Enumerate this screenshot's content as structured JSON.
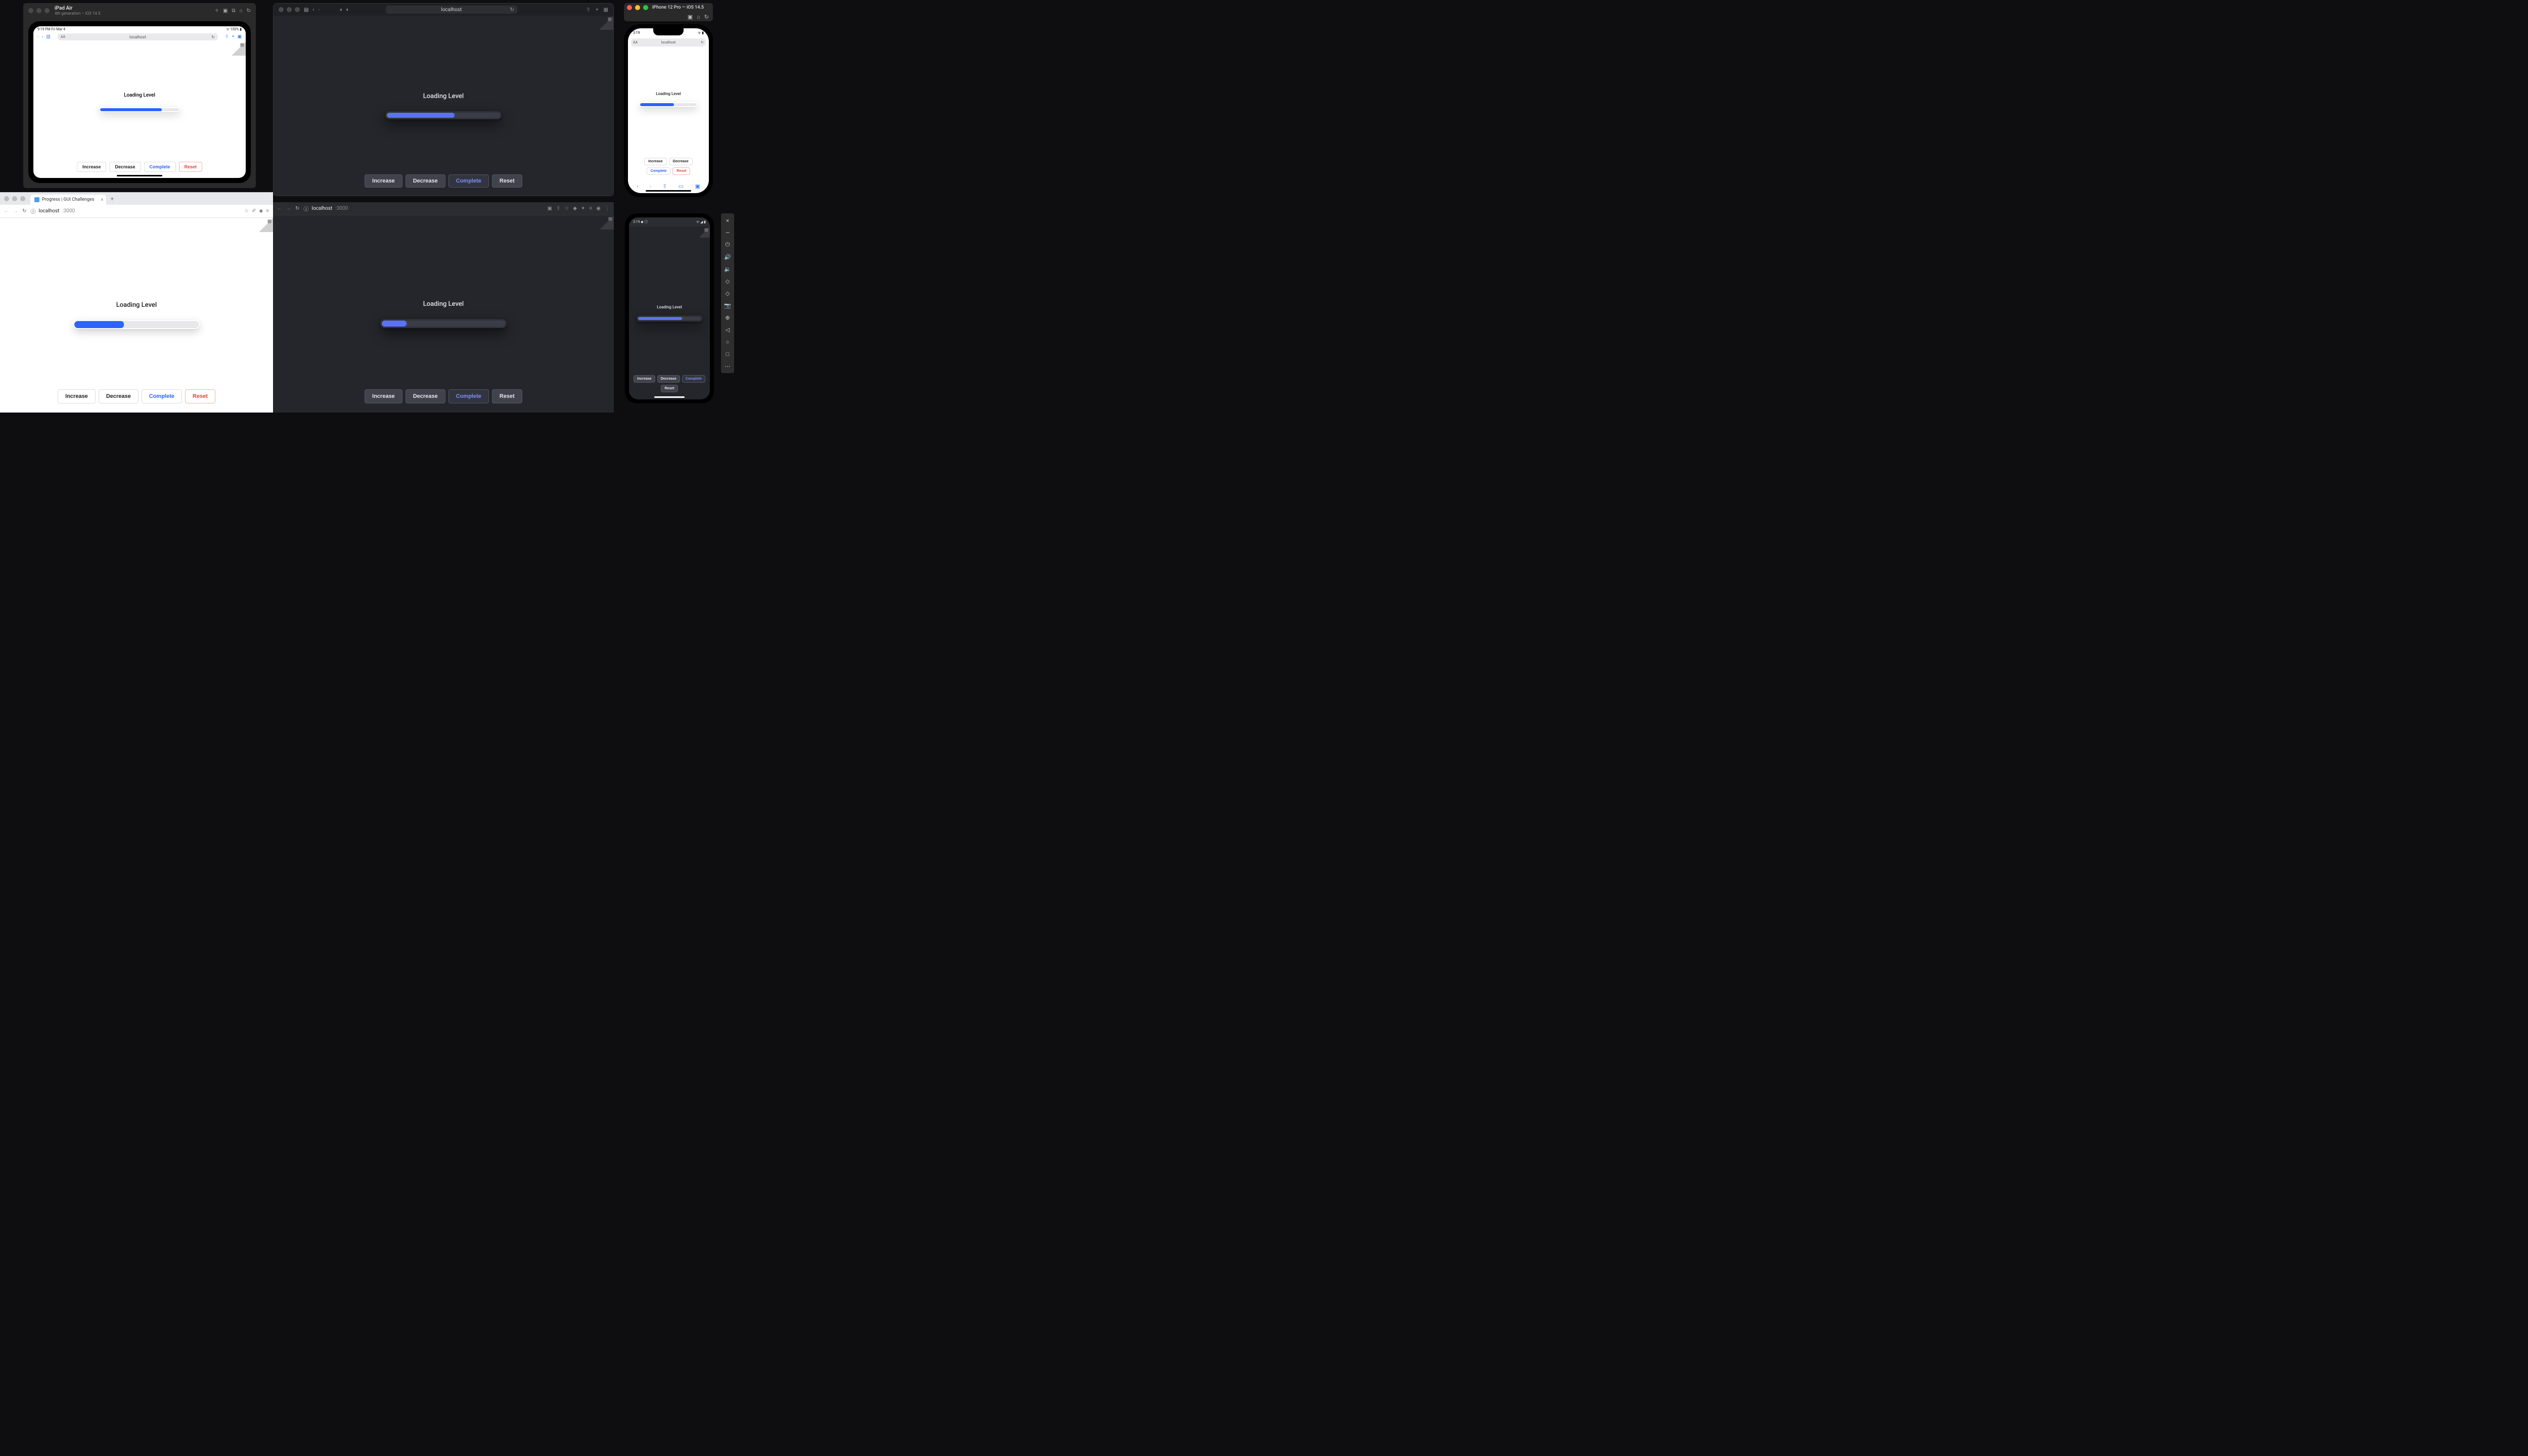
{
  "app": {
    "loading_label": "Loading Level",
    "buttons": {
      "increase": "Increase",
      "decrease": "Decrease",
      "complete": "Complete",
      "reset": "Reset"
    },
    "progress": {
      "ipad": 78,
      "safari_mac": 60,
      "chrome_light": 40,
      "chrome_dark": 20,
      "iphone": 60,
      "pixel": 70
    }
  },
  "ipad_sim": {
    "device_name": "iPad Air",
    "device_sub": "4th generation – iOS 14.5",
    "status_left": "9:19 PM  Fri Mar 4",
    "status_right": "100%",
    "url": "localhost"
  },
  "safari_mac": {
    "url": "localhost"
  },
  "chrome_light": {
    "tab_title": "Progress | GUI Challenges",
    "host": "localhost",
    "port": ":3000"
  },
  "chrome_dark": {
    "host": "localhost",
    "port": ":3000"
  },
  "iphone_sim": {
    "title": "iPhone 12 Pro — iOS 14.5",
    "time": "3:19",
    "url": "localhost"
  },
  "pixel_emu": {
    "time": "3:19"
  }
}
